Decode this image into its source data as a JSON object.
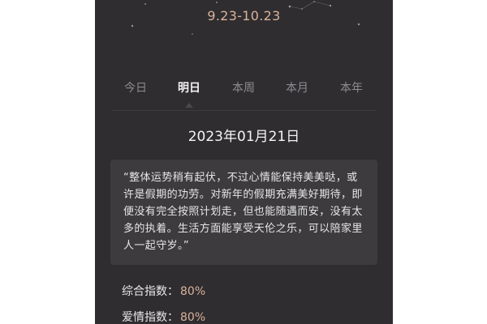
{
  "header": {
    "date_range": "9.23-10.23"
  },
  "tabs": [
    {
      "label": "今日",
      "active": false
    },
    {
      "label": "明日",
      "active": true
    },
    {
      "label": "本周",
      "active": false
    },
    {
      "label": "本月",
      "active": false
    },
    {
      "label": "本年",
      "active": false
    }
  ],
  "date": "2023年01月21日",
  "fortune_text": "“整体运势稍有起伏，不过心情能保持美美哒，或许是假期的功劳。对新年的假期充满美好期待，即便没有完全按照计划走，但也能随遇而安，没有太多的执着。生活方面能享受天伦之乐，可以陪家里人一起守岁。”",
  "indices": [
    {
      "label": "综合指数：",
      "value": "80%"
    },
    {
      "label": "爱情指数：",
      "value": "80%"
    }
  ],
  "colors": {
    "background": "#2f2d30",
    "accent": "#d9b39a",
    "card": "#3d3b3e"
  }
}
